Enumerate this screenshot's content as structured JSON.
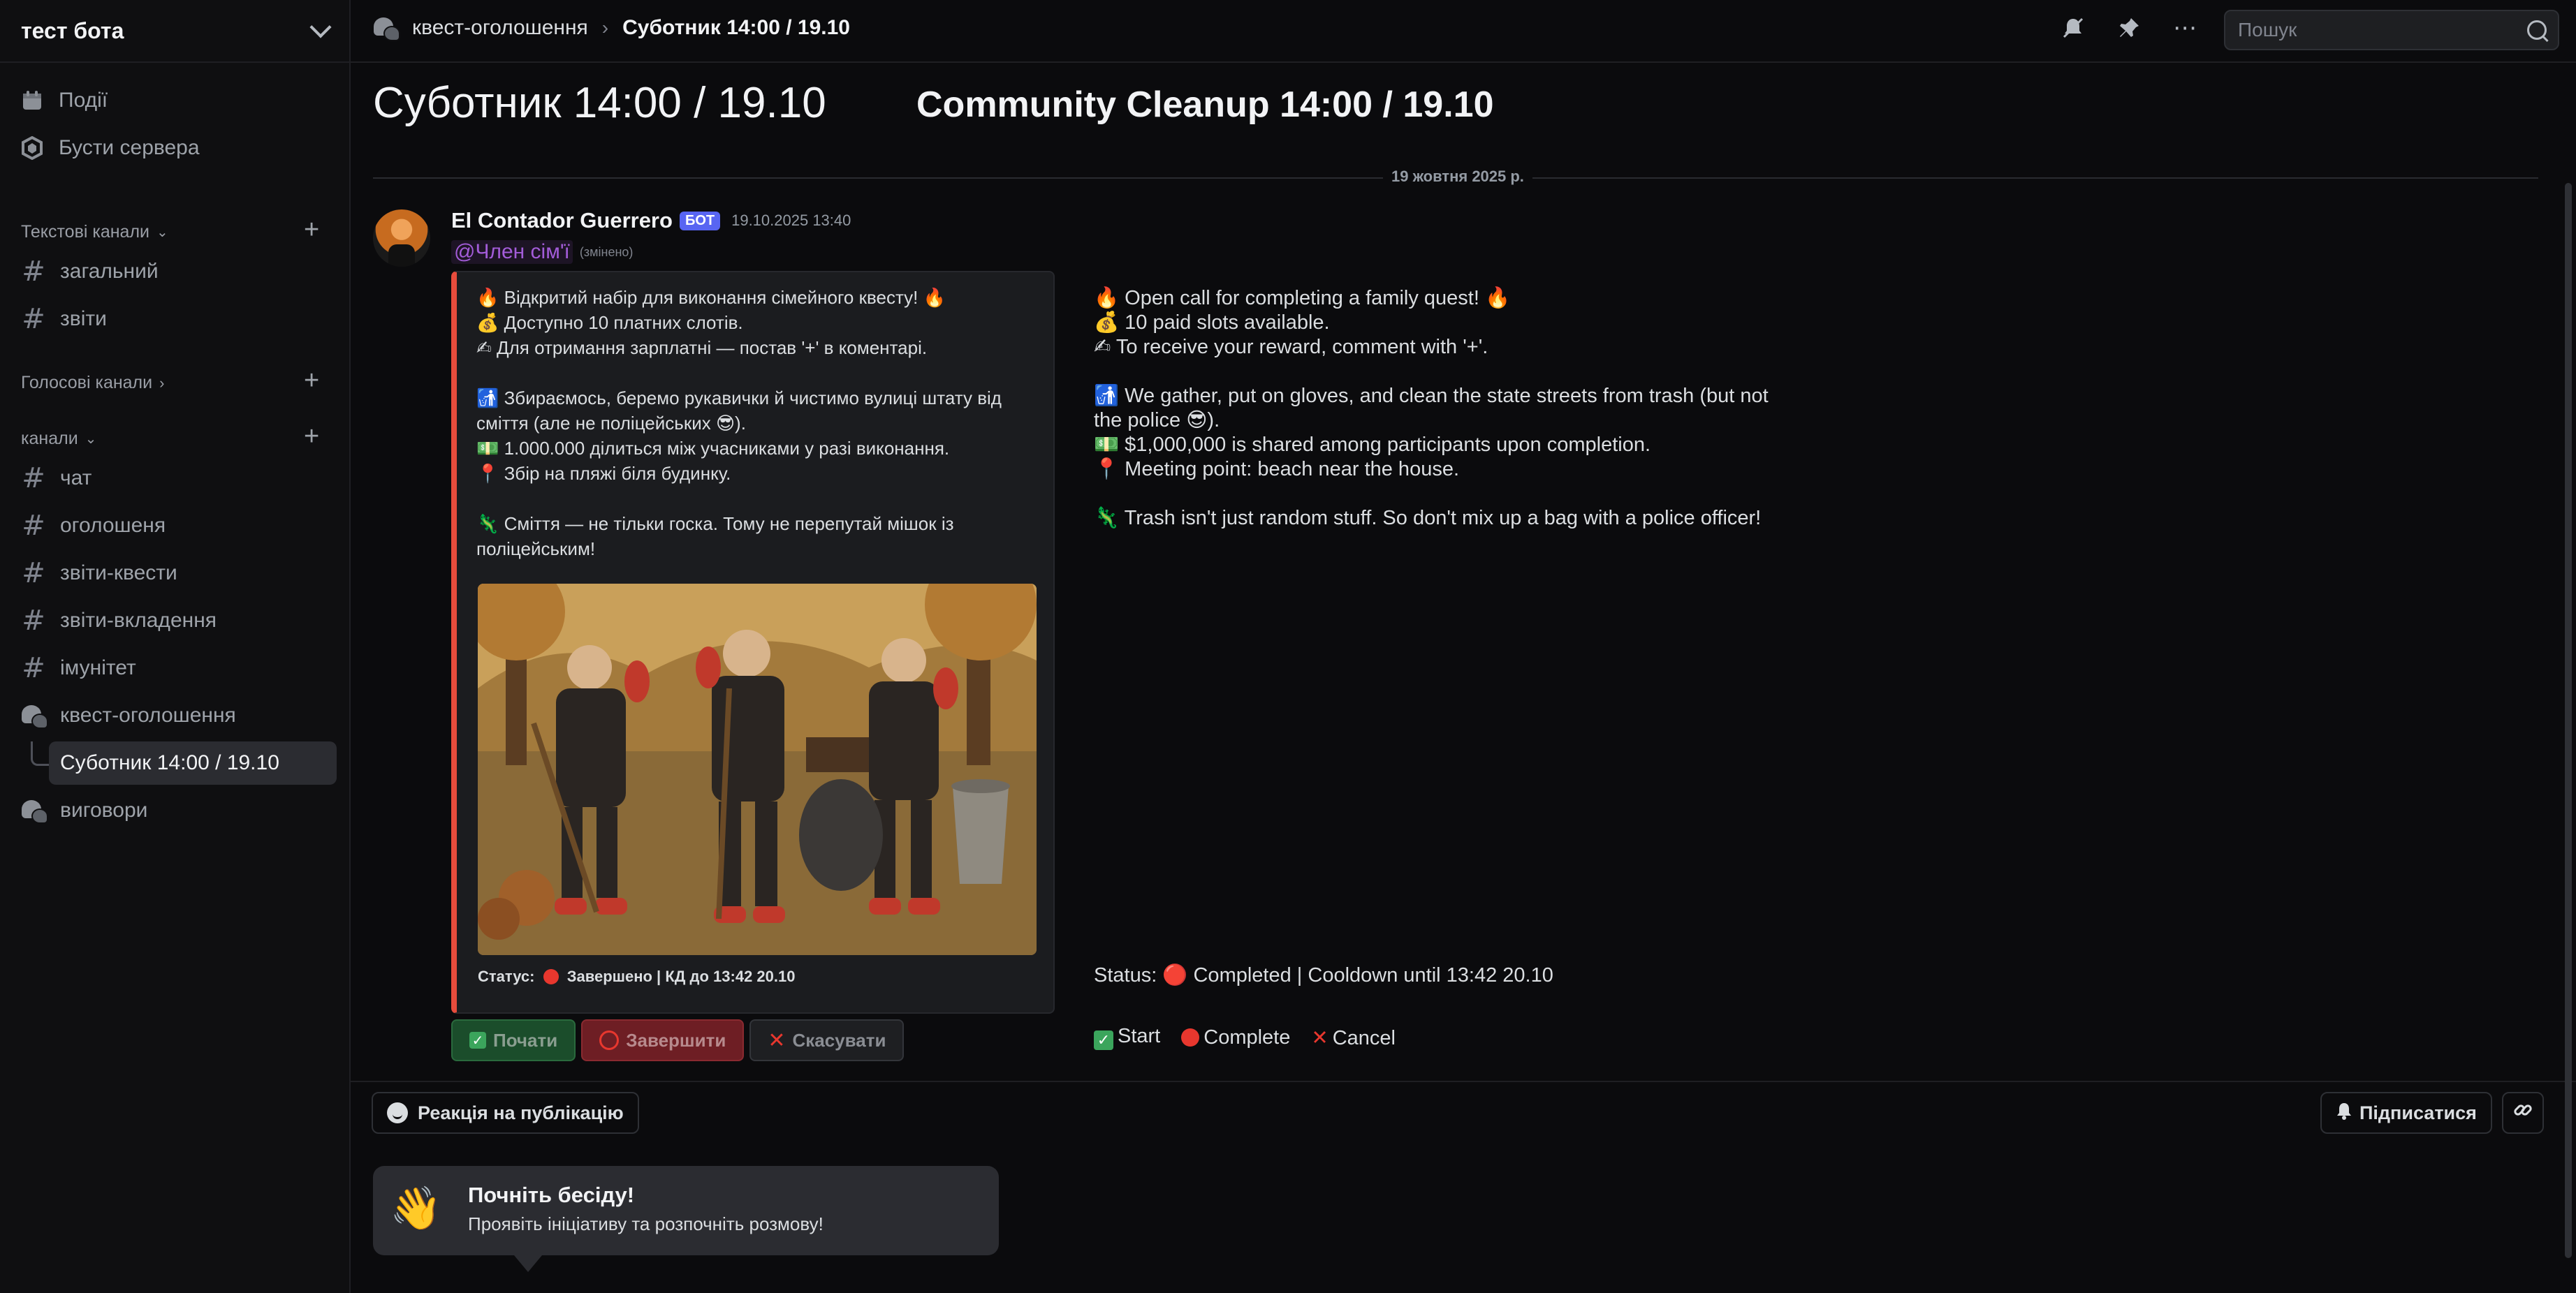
{
  "server": {
    "name": "тест бота"
  },
  "sidebar": {
    "top_items": [
      {
        "label": "Події",
        "icon": "calendar-icon"
      },
      {
        "label": "Бусти сервера",
        "icon": "boost-icon"
      }
    ],
    "categories": {
      "text": "Текстові канали",
      "voice": "Голосові канали",
      "channels": "канали"
    },
    "text_channels": [
      "загальний",
      "звіти"
    ],
    "channels": [
      "чат",
      "оголошеня",
      "звіти-квести",
      "звіти-вкладення",
      "імунітет"
    ],
    "forum_channel": "квест-оголошення",
    "active_thread": "Суботник 14:00 / 19.10",
    "other_forum": "виговори"
  },
  "topbar": {
    "breadcrumb_forum": "квест-оголошення",
    "breadcrumb_sep": "›",
    "breadcrumb_thread": "Суботник 14:00 / 19.10",
    "search_placeholder": "Пошук"
  },
  "main": {
    "title": "Суботник 14:00 / 19.10",
    "title_translation": "Community Cleanup 14:00 / 19.10",
    "divider_date": "19 жовтня 2025 р.",
    "message": {
      "author": "El Contador Guerrero",
      "bot_tag": "БОТ",
      "timestamp": "19.10.2025 13:40",
      "mention": "@Член сім'ї",
      "edited": "(змінено)",
      "embed_text": "🔥 Відкритий набір для виконання сімейного квесту! 🔥\n💰 Доступно 10 платних слотів.\n✍ Для отримання зарплатні — постав '+' в коментарі.\n\n🚮 Збираємось, беремо рукавички й чистимо вулиці штату від сміття (але не поліцейських 😎).\n💵 1.000.000 ділиться між учасниками у разі виконання.\n📍 Збір на пляжі біля будинку.\n\n🦎 Сміття — не тільки госка. Тому не перепутай мішок із поліцейським!",
      "status_label": "Статус:",
      "status_value": "Завершено | КД до 13:42 20.10",
      "buttons": {
        "start": "Почати",
        "complete": "Завершити",
        "cancel": "Скасувати"
      }
    },
    "translation": {
      "text": "🔥 Open call for completing a family quest! 🔥\n💰 10 paid slots available.\n✍ To receive your reward, comment with '+'.\n\n🚮 We gather, put on gloves, and clean the state streets from trash (but not the police 😎).\n💵 $1,000,000 is shared among participants upon completion.\n📍 Meeting point: beach near the house.\n\n🦎 Trash isn't just random stuff. So don't mix up a bag with a police officer!",
      "status": "Status: 🔴 Completed | Cooldown until 13:42 20.10",
      "start": "Start",
      "complete": "Complete",
      "cancel": "Cancel"
    },
    "reaction_button": "Реакція на публікацію",
    "subscribe_button": "Підписатися",
    "starter": {
      "title": "Почніть бесіду!",
      "subtitle": "Проявіть ініціативу та розпочніть розмову!"
    }
  },
  "colors": {
    "accent": "#5865f2",
    "embed_bar": "#e74c3c",
    "success": "#3ba55c",
    "danger": "#e8372e",
    "mention": "#a35cd9"
  }
}
